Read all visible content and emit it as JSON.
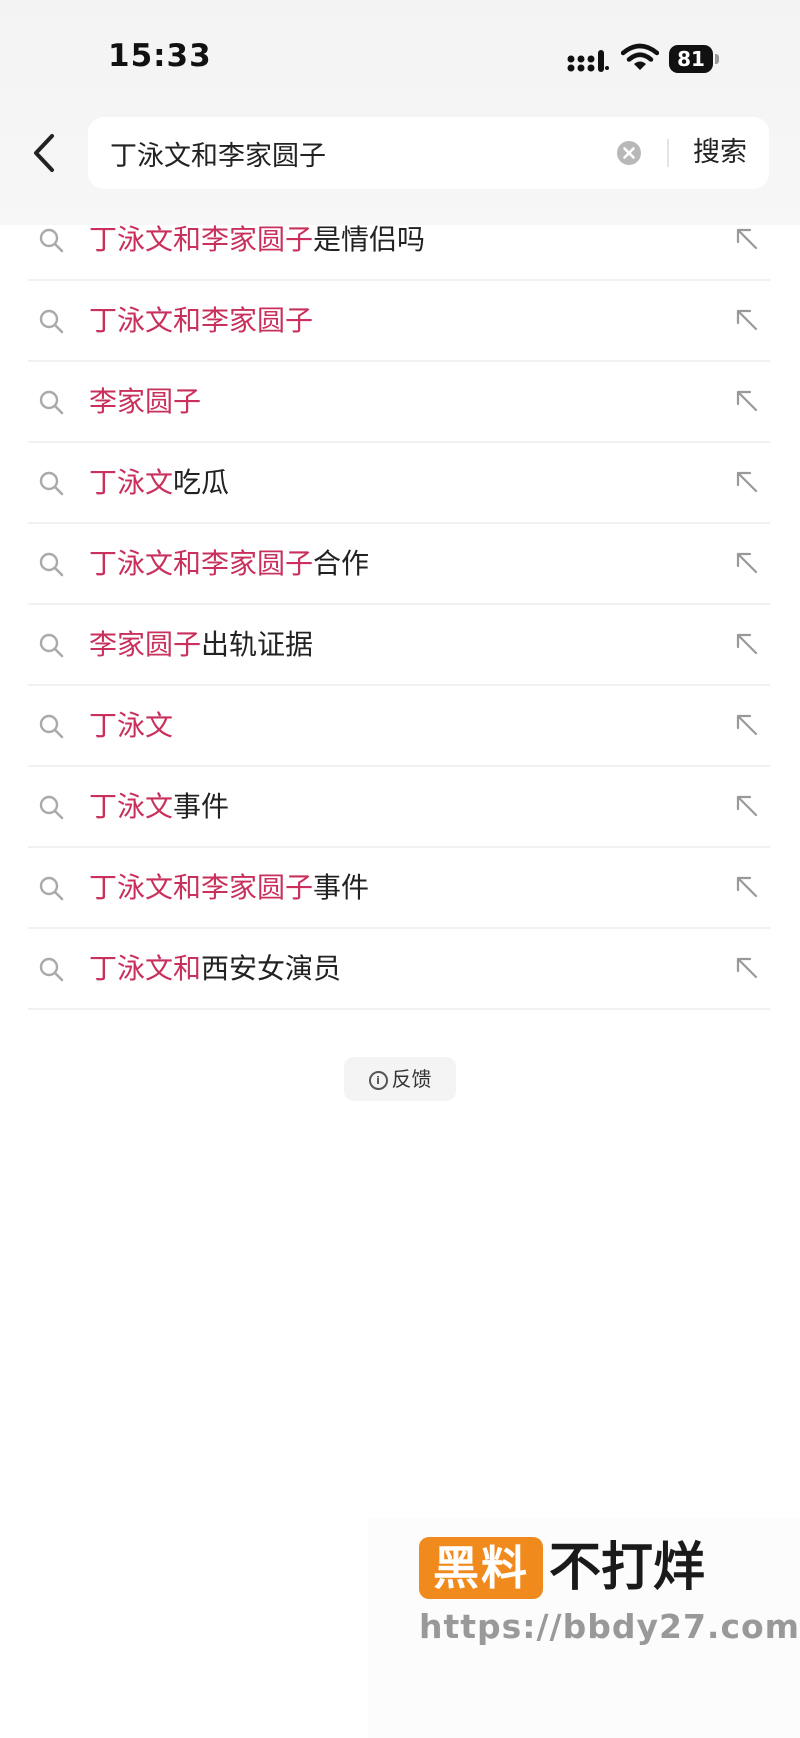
{
  "status_bar": {
    "time": "15:33",
    "battery": "81"
  },
  "header": {
    "search_query": "丁泳文和李家圆子",
    "search_button": "搜索"
  },
  "suggestions": [
    {
      "highlight": "丁泳文和李家圆子",
      "rest": "是情侣吗"
    },
    {
      "highlight": "丁泳文和李家圆子",
      "rest": ""
    },
    {
      "highlight": "李家圆子",
      "rest": ""
    },
    {
      "highlight": "丁泳文",
      "rest": "吃瓜"
    },
    {
      "highlight": "丁泳文和李家圆子",
      "rest": "合作"
    },
    {
      "highlight": "李家圆子",
      "rest": "出轨证据"
    },
    {
      "highlight": "丁泳文",
      "rest": ""
    },
    {
      "highlight": "丁泳文",
      "rest": "事件"
    },
    {
      "highlight": "丁泳文和李家圆子",
      "rest": "事件"
    },
    {
      "highlight": "丁泳文和",
      "rest": "西安女演员"
    }
  ],
  "feedback_label": "反馈",
  "watermark": {
    "badge": "黑料",
    "title": "不打烊",
    "url": "https://bbdy27.com"
  },
  "colors": {
    "highlight": "#c9305b",
    "watermark_badge": "#f08a1c"
  }
}
